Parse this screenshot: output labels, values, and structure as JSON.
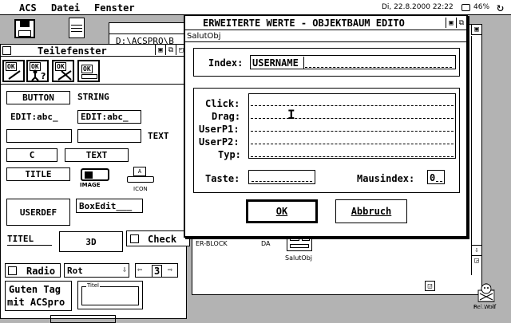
{
  "menubar": {
    "items": [
      "ACS",
      "Datei",
      "Fenster"
    ],
    "clock": "Di, 22.8.2000 22:22",
    "battery": "46%"
  },
  "desktop": {
    "bg_window_path": "D:\\ACSPRO\\B",
    "bg_block_label": "ER-BLOCK",
    "bg_da_label": "DA",
    "tree_object_label": "SalutObj",
    "mascot_label": "Rei.Wolf"
  },
  "teilefenster": {
    "title": "Teilefenster",
    "toolbar": [
      "OK",
      "OK",
      "OK",
      "OK"
    ],
    "parts": {
      "button": "BUTTON",
      "string": "STRING",
      "edit1": "EDIT:abc_",
      "edit2": "EDIT:abc_",
      "text_label": "TEXT",
      "c": "C",
      "text_btn": "TEXT",
      "title": "TITLE",
      "image_caption": "IMAGE",
      "icon_caption": "ICON",
      "userdef": "USERDEF",
      "boxedit": "BoxEdit___",
      "titel": "TITEL",
      "three_d": "3D",
      "check": "Check",
      "radio": "Radio",
      "rot": "Rot",
      "spin_value": "3",
      "guten": "Guten Tag",
      "mit": "mit ACSpro",
      "group_title": "Titel"
    }
  },
  "dialog": {
    "title": "ERWEITERTE WERTE - OBJEKTBAUM EDITO",
    "subtitle": "SalutObj",
    "index_label": "Index:",
    "index_value": "USERNAME",
    "fields": [
      "Click:",
      "Drag:",
      "UserP1:",
      "UserP2:",
      "Typ:"
    ],
    "taste_label": "Taste:",
    "maus_label": "Mausindex:",
    "maus_value": "0",
    "ok": "OK",
    "abbruch": "Abbruch"
  }
}
